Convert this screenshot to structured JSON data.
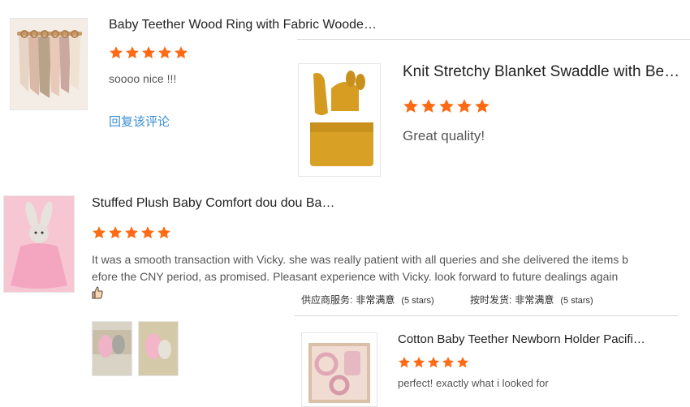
{
  "reviews": [
    {
      "title": "Baby Teether Wood Ring with Fabric Wooden T...",
      "text": "soooo nice !!!",
      "reply_link": "回复该评论"
    },
    {
      "title": "Knit Stretchy Blanket Swaddle with Beanie Bab...",
      "text": "Great quality!"
    },
    {
      "title": "Stuffed Plush Baby Comfort dou dou Baby Plus...",
      "text_line1": "It was a smooth transaction with Vicky. she was really patient with all queries and she delivered the items b",
      "text_line2": "efore the CNY period, as promised. Pleasant experience with Vicky. look forward to future dealings again",
      "emoji_icon": "thumbs-up-icon",
      "service_label": "供应商服务:",
      "service_value": "非常满意",
      "service_stars": "(5 stars)",
      "shipping_label": "按时发货:",
      "shipping_value": "非常满意",
      "shipping_stars": "(5 stars)"
    },
    {
      "title": "Cotton Baby Teether Newborn Holder Pacifier ...",
      "text": "perfect! exactly what i looked for"
    }
  ],
  "rating": 5,
  "colors": {
    "star": "#ff6a14",
    "link": "#3a8fd6"
  }
}
